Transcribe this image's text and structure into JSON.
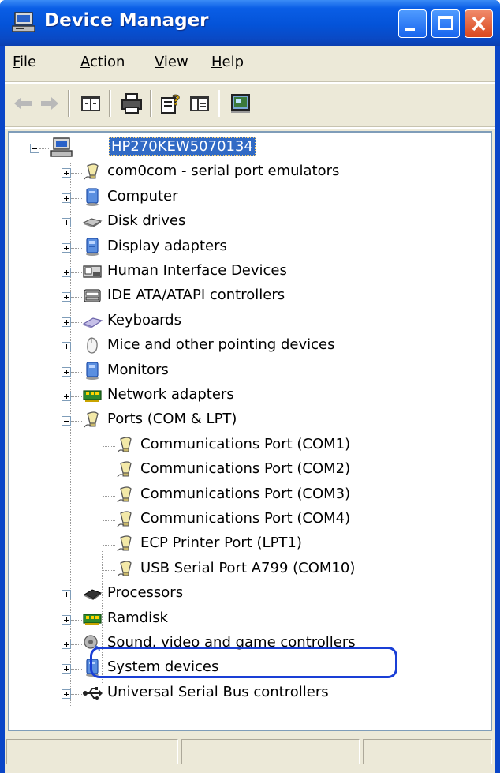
{
  "window": {
    "title": "Device Manager",
    "titlebar_color": "#0453d8",
    "buttons": {
      "minimize": "minimize",
      "maximize": "maximize",
      "close": "close"
    }
  },
  "menu": [
    {
      "key": "F",
      "rest": "ile"
    },
    {
      "key": "A",
      "rest": "ction"
    },
    {
      "key": "V",
      "rest": "iew"
    },
    {
      "key": "H",
      "rest": "elp"
    }
  ],
  "toolbar": {
    "icons": [
      "back-arrow-icon",
      "forward-arrow-icon",
      "show-hide-console-tree-icon",
      "print-icon",
      "help-icon",
      "properties-icon",
      "scan-hardware-icon"
    ]
  },
  "tree": {
    "root": "HP270KEW5070134",
    "categories": [
      {
        "label": "com0com - serial port emulators",
        "icon": "port-icon",
        "expanded": false
      },
      {
        "label": "Computer",
        "icon": "computer-icon",
        "expanded": false
      },
      {
        "label": "Disk drives",
        "icon": "disk-drive-icon",
        "expanded": false
      },
      {
        "label": "Display adapters",
        "icon": "display-icon",
        "expanded": false
      },
      {
        "label": "Human Interface Devices",
        "icon": "hid-icon",
        "expanded": false
      },
      {
        "label": "IDE ATA/ATAPI controllers",
        "icon": "ide-icon",
        "expanded": false
      },
      {
        "label": "Keyboards",
        "icon": "keyboard-icon",
        "expanded": false
      },
      {
        "label": "Mice and other pointing devices",
        "icon": "mouse-icon",
        "expanded": false
      },
      {
        "label": "Monitors",
        "icon": "monitor-icon",
        "expanded": false
      },
      {
        "label": "Network adapters",
        "icon": "network-icon",
        "expanded": false
      },
      {
        "label": "Ports (COM & LPT)",
        "icon": "port-icon",
        "expanded": true,
        "children": [
          "Communications Port (COM1)",
          "Communications Port (COM2)",
          "Communications Port (COM3)",
          "Communications Port (COM4)",
          "ECP Printer Port (LPT1)",
          "USB Serial Port A799 (COM10)"
        ]
      },
      {
        "label": "Processors",
        "icon": "processor-icon",
        "expanded": false
      },
      {
        "label": "Ramdisk",
        "icon": "ram-icon",
        "expanded": false
      },
      {
        "label": "Sound, video and game controllers",
        "icon": "sound-icon",
        "expanded": false
      },
      {
        "label": "System devices",
        "icon": "system-icon",
        "expanded": false
      },
      {
        "label": "Universal Serial Bus controllers",
        "icon": "usb-icon",
        "expanded": false
      }
    ],
    "highlighted_child": "USB Serial Port A799 (COM10)",
    "highlight_color": "#1a3fd6",
    "selection_color": "#316ac5"
  }
}
